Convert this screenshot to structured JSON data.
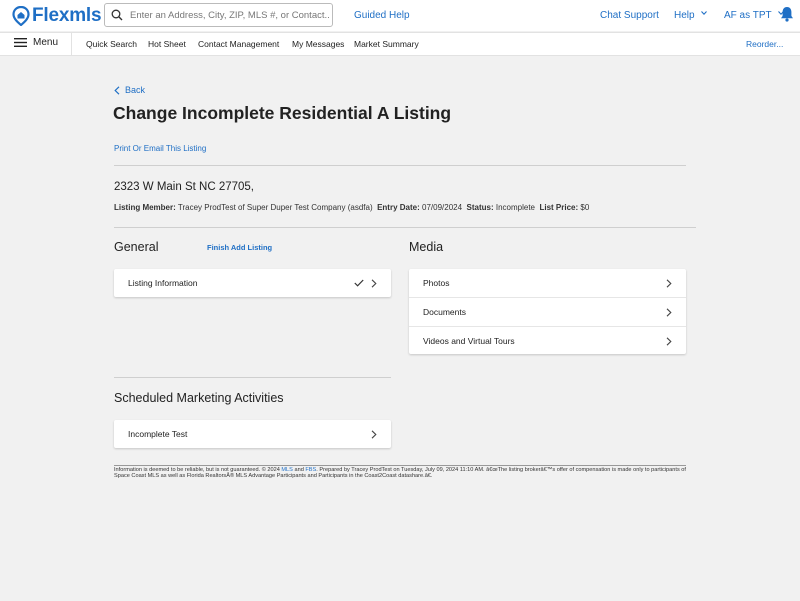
{
  "header": {
    "logo_text": "Flexmls",
    "search_placeholder": "Enter an Address, City, ZIP, MLS #, or Contact...",
    "guided_help": "Guided Help",
    "chat_support": "Chat Support",
    "help": "Help",
    "user": "AF as TPT"
  },
  "nav": {
    "menu": "Menu",
    "items": [
      "Quick Search",
      "Hot Sheet",
      "Contact Management",
      "My Messages",
      "Market Summary"
    ],
    "reorder": "Reorder..."
  },
  "page": {
    "back": "Back",
    "title": "Change Incomplete Residential A Listing",
    "print_link": "Print Or Email This Listing",
    "address": "2323 W Main St NC 27705,",
    "meta": {
      "member_label": "Listing Member:",
      "member_value": "Tracey ProdTest of Super Duper Test Company (asdfa)",
      "entry_label": "Entry Date:",
      "entry_value": "07/09/2024",
      "status_label": "Status:",
      "status_value": "Incomplete",
      "price_label": "List Price:",
      "price_value": "$0"
    }
  },
  "general": {
    "title": "General",
    "finish_link": "Finish Add Listing",
    "items": [
      "Listing Information"
    ]
  },
  "media": {
    "title": "Media",
    "items": [
      "Photos",
      "Documents",
      "Videos and Virtual Tours"
    ]
  },
  "marketing": {
    "title": "Scheduled Marketing Activities",
    "items": [
      "Incomplete Test"
    ]
  },
  "footer": {
    "part1": "Information is deemed to be reliable, but is not guaranteed. © 2024",
    "mls_link": "MLS",
    "and": "and",
    "fbs_link": "FBS",
    "part2": ". Prepared by Tracey ProdTest on Tuesday, July 09, 2024 11:10 AM. â€œThe listing brokerâ€™s offer of compensation is made only to participants of Space Coast MLS as well as Florida RealtorsÂ® MLS Advantage Participants and Participants in the Coast2Coast datashare.â€."
  },
  "colors": {
    "brand": "#1f6fc5",
    "background": "#f1f1f1",
    "notification": "#1f6fc5"
  }
}
